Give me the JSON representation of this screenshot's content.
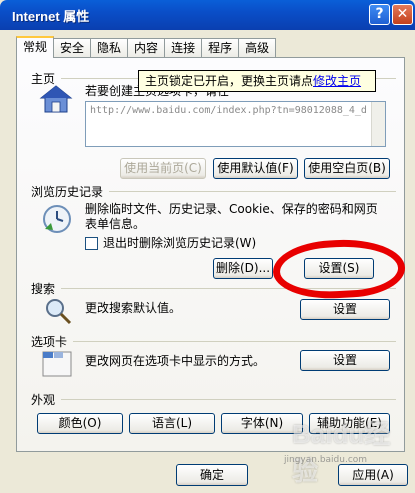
{
  "window": {
    "title": "Internet 属性",
    "help": "?",
    "close": "✕"
  },
  "tabs": [
    "常规",
    "安全",
    "隐私",
    "内容",
    "连接",
    "程序",
    "高级"
  ],
  "homepage": {
    "label": "主页",
    "desc": "若要创建主页选项卡，请在",
    "url": "http://www.baidu.com/index.php?tn=98012088_4_d",
    "btn_current": "使用当前页(C)",
    "btn_default": "使用默认值(F)",
    "btn_blank": "使用空白页(B)",
    "tooltip_text": "主页锁定已开启，更换主页请点",
    "tooltip_link": "修改主页"
  },
  "history": {
    "label": "浏览历史记录",
    "desc_line1": "删除临时文件、历史记录、Cookie、保存的密码和网页",
    "desc_line2": "表单信息。",
    "checkbox_label": "退出时删除浏览历史记录(W)",
    "btn_delete": "删除(D)...",
    "btn_settings": "设置(S)"
  },
  "search": {
    "label": "搜索",
    "desc": "更改搜索默认值。",
    "btn_settings": "设置"
  },
  "tabsection": {
    "label": "选项卡",
    "desc": "更改网页在选项卡中显示的方式。",
    "btn_settings": "设置"
  },
  "appearance": {
    "label": "外观",
    "btn_colors": "颜色(O)",
    "btn_languages": "语言(L)",
    "btn_fonts": "字体(N)",
    "btn_accessibility": "辅助功能(E)"
  },
  "footer": {
    "ok": "确定",
    "apply": "应用(A)"
  },
  "watermark": {
    "text": "Baidu经验",
    "sub": "jingyan.baidu.com"
  },
  "colors": {
    "title_bar": "#0a4ec8",
    "highlight": "#e80000",
    "tooltip_bg": "#ffffe1"
  }
}
